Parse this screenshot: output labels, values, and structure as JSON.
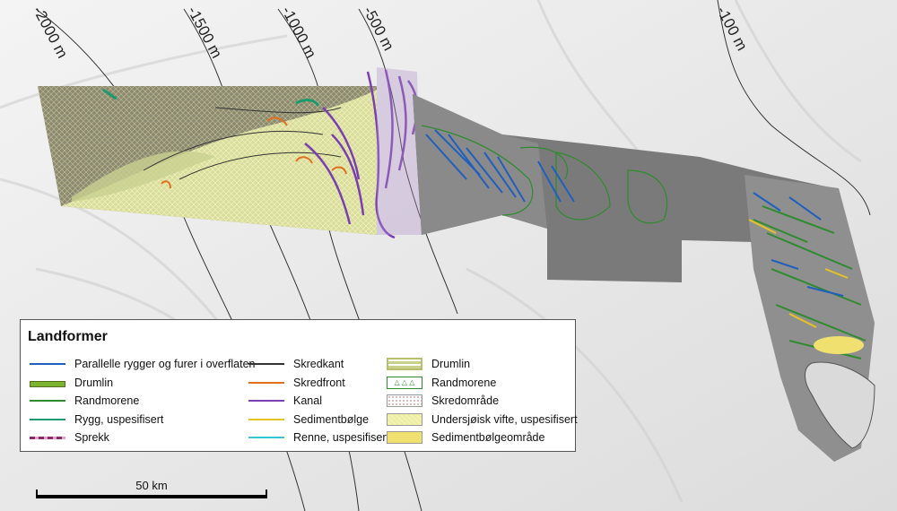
{
  "depth_labels": [
    "-2000 m",
    "-1500 m",
    "-1000 m",
    "-500 m",
    "-100 m"
  ],
  "legend": {
    "title": "Landformer",
    "items": [
      {
        "label": "Parallelle rygger og furer i overflaten",
        "kind": "line",
        "color": "#1f5fbf",
        "icon": "blue-line-icon"
      },
      {
        "label": "Drumlin",
        "kind": "thick-line",
        "color": "#7ab32e",
        "icon": "green-thick-line-icon"
      },
      {
        "label": "Randmorene",
        "kind": "line",
        "color": "#2e8b2e",
        "icon": "green-line-icon"
      },
      {
        "label": "Rygg, uspesifisert",
        "kind": "line",
        "color": "#1a9a6e",
        "icon": "teal-line-icon"
      },
      {
        "label": "Sprekk",
        "kind": "dash-line",
        "color": "#8a2a6a",
        "icon": "purple-dashed-line-icon"
      },
      {
        "label": "Skredkant",
        "kind": "line",
        "color": "#333333",
        "icon": "black-line-icon"
      },
      {
        "label": "Skredfront",
        "kind": "line",
        "color": "#e07020",
        "icon": "orange-line-icon"
      },
      {
        "label": "Kanal",
        "kind": "line",
        "color": "#7a3fb0",
        "icon": "purple-line-icon"
      },
      {
        "label": "Sedimentbølge",
        "kind": "line",
        "color": "#e5c320",
        "icon": "yellow-line-icon"
      },
      {
        "label": "Renne, uspesifisert",
        "kind": "line",
        "color": "#35c6d0",
        "icon": "cyan-line-icon"
      },
      {
        "label": "Drumlin",
        "kind": "fill-striped",
        "color": "#c8d08a",
        "icon": "drumlin-area-icon"
      },
      {
        "label": "Randmorene",
        "kind": "fill-outline",
        "color": "#2e8b2e",
        "icon": "moraine-area-icon"
      },
      {
        "label": "Skredområde",
        "kind": "fill-dots",
        "color": "#d4a0a0",
        "icon": "slide-area-icon"
      },
      {
        "label": "Undersjøisk vifte, uspesifisert",
        "kind": "fill-hatch",
        "color": "#f3f3b0",
        "icon": "fan-area-icon"
      },
      {
        "label": "Sedimentbølgeområde",
        "kind": "fill-solid",
        "color": "#f0e070",
        "icon": "sediment-wave-area-icon"
      }
    ]
  },
  "scale": {
    "label": "50 km"
  }
}
